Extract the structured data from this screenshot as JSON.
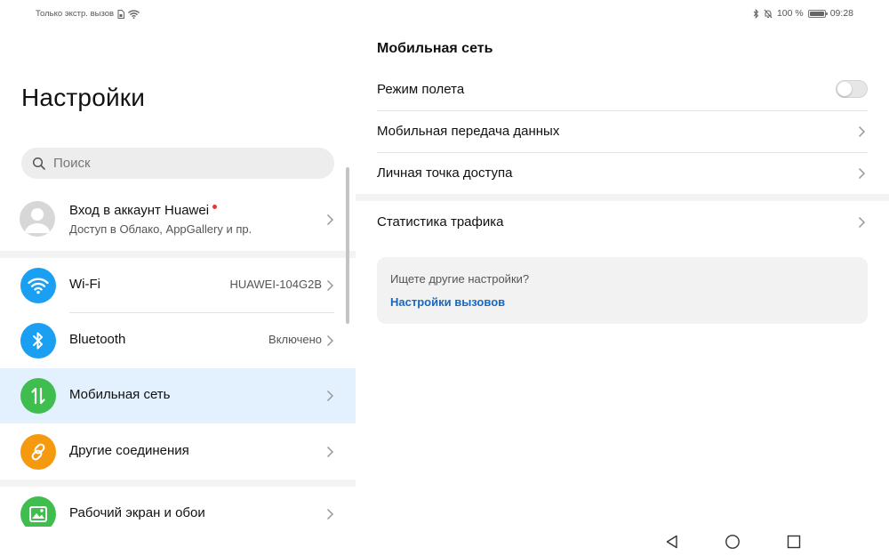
{
  "status_bar": {
    "left_text": "Только экстр. вызов",
    "battery": "100 %",
    "battery_level": 1.0,
    "time": "09:28"
  },
  "left_pane": {
    "title": "Настройки",
    "search": {
      "placeholder": "Поиск"
    },
    "account": {
      "title": "Вход в аккаунт Huawei",
      "subtitle": "Доступ в Облако, AppGallery и пр."
    },
    "items": [
      {
        "label": "Wi-Fi",
        "value": "HUAWEI-104G2B",
        "icon": "wifi-icon",
        "color": "#1a9ff2"
      },
      {
        "label": "Bluetooth",
        "value": "Включено",
        "icon": "bluetooth-icon",
        "color": "#1a9ff2"
      },
      {
        "label": "Мобильная сеть",
        "value": "",
        "icon": "mobile-data-icon",
        "color": "#3fbe4f",
        "selected": true
      },
      {
        "label": "Другие соединения",
        "value": "",
        "icon": "link-icon",
        "color": "#f59a0e"
      },
      {
        "label": "Рабочий экран и обои",
        "value": "",
        "icon": "wallpaper-icon",
        "color": "#3fbe4f"
      }
    ]
  },
  "right_pane": {
    "header": "Мобильная сеть",
    "rows": [
      {
        "label": "Режим полета",
        "control": "toggle",
        "on": false
      },
      {
        "label": "Мобильная передача данных",
        "control": "chevron"
      },
      {
        "label": "Личная точка доступа",
        "control": "chevron"
      },
      {
        "label": "Статистика трафика",
        "control": "chevron"
      }
    ],
    "suggestion": {
      "question": "Ищете другие настройки?",
      "link": "Настройки вызовов"
    }
  },
  "colors": {
    "accent_link": "#1769c2",
    "selected_row": "#e3f0fd",
    "notification_dot": "#e53935"
  }
}
